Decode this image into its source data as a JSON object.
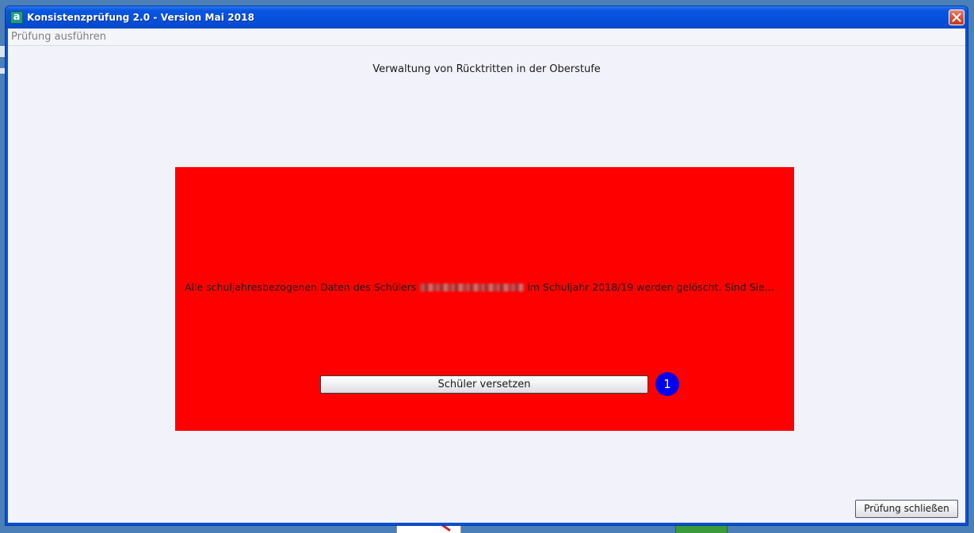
{
  "window": {
    "title": "Konsistenzprüfung 2.0 - Version Mai 2018",
    "app_icon_glyph": "a",
    "app_icon_name": "app-logo-icon",
    "close_icon_name": "close-icon"
  },
  "menubar": {
    "items": [
      {
        "label": "Prüfung ausführen",
        "enabled": false
      }
    ]
  },
  "main": {
    "title": "Verwaltung von Rücktritten in der Oberstufe",
    "panel": {
      "background_color": "#ff0000",
      "message_before_name": "Alle schuljahresbezogenen Daten des Schülers",
      "message_after_name": "im Schuljahr 2018/19 werden gelöscht. Sind Sie...",
      "action_button_label": "Schüler versetzen",
      "step_badge": "1",
      "step_badge_color": "#0000ee"
    }
  },
  "footer": {
    "close_button_label": "Prüfung schließen"
  },
  "colors": {
    "titlebar": "#0550dc",
    "client_background": "#f2f2fb",
    "desktop": "#4a7fb8"
  }
}
